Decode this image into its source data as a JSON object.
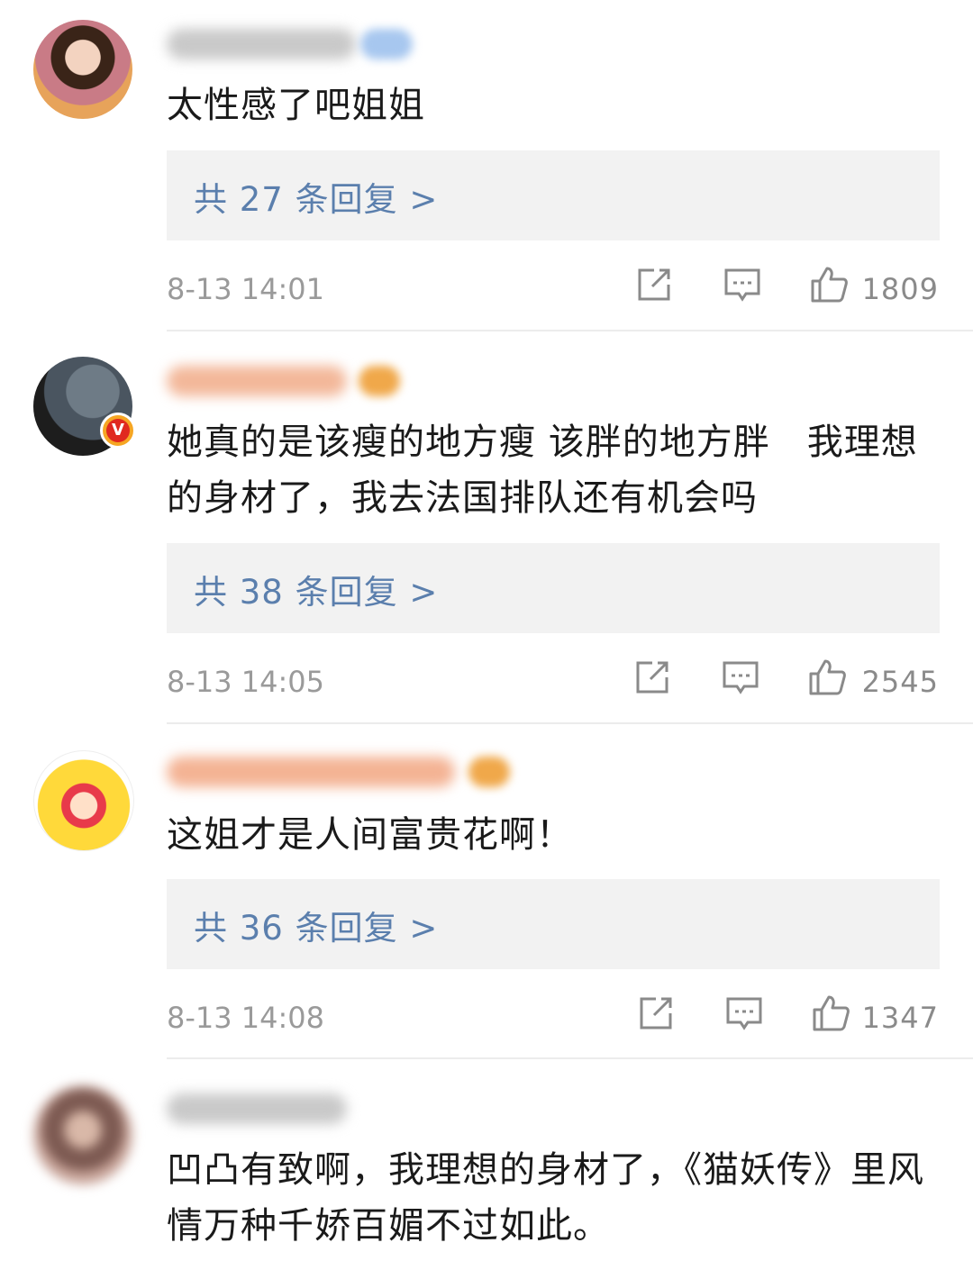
{
  "comments": [
    {
      "text": "太性感了吧姐姐",
      "reply_label": "共 27 条回复 >",
      "time": "8-13 14:01",
      "likes": "1809",
      "avatar": "woman-portrait-avatar",
      "verified": false
    },
    {
      "text": "她真的是该瘦的地方瘦 该胖的地方胖　我理想的身材了，我去法国排队还有机会吗",
      "reply_label": "共 38 条回复 >",
      "time": "8-13 14:05",
      "likes": "2545",
      "avatar": "cat-avatar",
      "verified": true
    },
    {
      "text": "这姐才是人间富贵花啊！",
      "reply_label": "共 36 条回复 >",
      "time": "8-13 14:08",
      "likes": "1347",
      "avatar": "sailor-moon-cartoon-avatar",
      "verified": false
    },
    {
      "text": "凹凸有致啊，我理想的身材了，《猫妖传》里风情万种千娇百媚不过如此。",
      "avatar": "blurred-person-avatar",
      "verified": false
    }
  ],
  "icons": {
    "share": "share-icon",
    "comment": "comment-icon",
    "like": "thumbs-up-icon"
  },
  "colors": {
    "reply_link": "#5b7fad",
    "reply_bg": "#f2f2f2",
    "meta_gray": "#9a9a9a",
    "text": "#1a1a1a"
  }
}
